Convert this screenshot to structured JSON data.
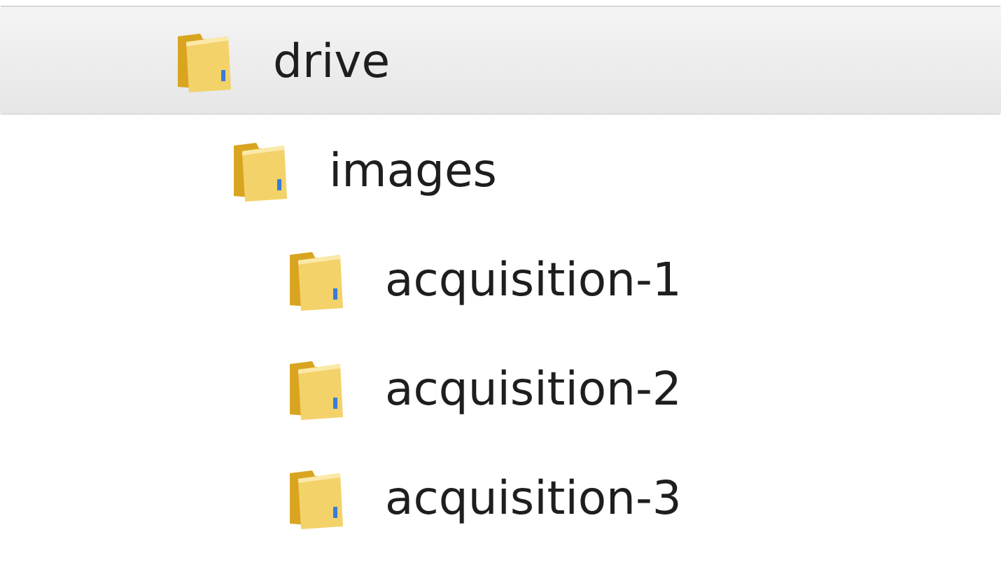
{
  "tree": [
    {
      "label": "drive",
      "selected": true,
      "children": [
        {
          "label": "images",
          "selected": false,
          "children": [
            {
              "label": "acquisition-1",
              "selected": false
            },
            {
              "label": "acquisition-2",
              "selected": false
            },
            {
              "label": "acquisition-3",
              "selected": false
            }
          ]
        }
      ]
    }
  ]
}
